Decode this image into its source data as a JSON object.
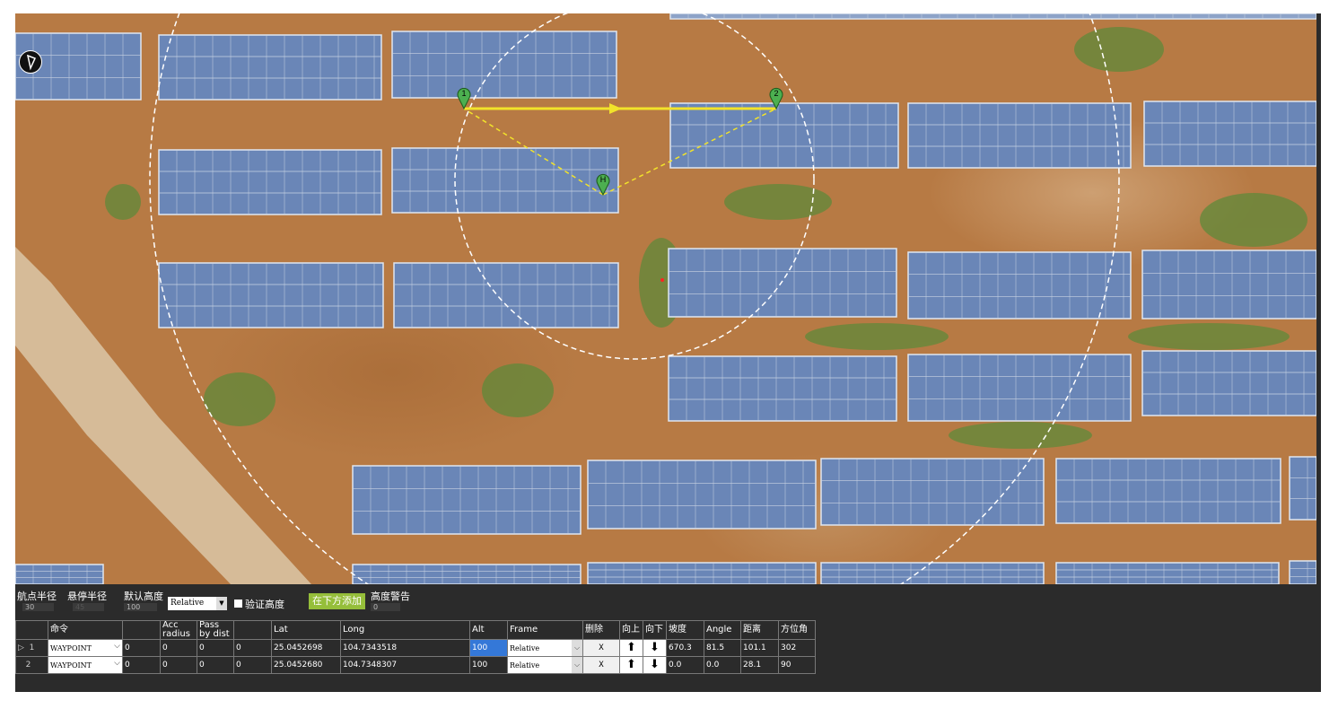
{
  "controls": {
    "wp_radius_label": "航点半径",
    "wp_radius_value": "30",
    "loiter_radius_label": "悬停半径",
    "loiter_radius_value": "45",
    "default_alt_label": "默认高度",
    "default_alt_value": "100",
    "alt_frame_value": "Relative",
    "verify_height_label": "验证高度",
    "add_below_label": "在下方添加",
    "alt_warn_label": "高度警告",
    "alt_warn_value": "0"
  },
  "map": {
    "waypoints": [
      {
        "label": "1"
      },
      {
        "label": "2"
      },
      {
        "label": "H"
      }
    ],
    "colors": {
      "route": "#f2e32a",
      "marker": "#4caf50",
      "ground": "#b77a44",
      "panel": "#6a86b7"
    }
  },
  "table": {
    "headers": [
      "",
      "命令",
      "",
      "Acc radius",
      "Pass by dist",
      "",
      "Lat",
      "Long",
      "Alt",
      "Frame",
      "删除",
      "向上",
      "向下",
      "坡度",
      "Angle",
      "距离",
      "方位角"
    ],
    "rows": [
      {
        "marker": "▷",
        "num": "1",
        "command": "WAYPOINT",
        "p1": "0",
        "p2": "0",
        "p3": "0",
        "p4": "0",
        "lat": "25.0452698",
        "long": "104.7343518",
        "alt": "100",
        "frame": "Relative",
        "delete": "X",
        "grad": "670.3",
        "angle": "81.5",
        "dist": "101.1",
        "az": "302"
      },
      {
        "marker": "",
        "num": "2",
        "command": "WAYPOINT",
        "p1": "0",
        "p2": "0",
        "p3": "0",
        "p4": "0",
        "lat": "25.0452680",
        "long": "104.7348307",
        "alt": "100",
        "frame": "Relative",
        "delete": "X",
        "grad": "0.0",
        "angle": "0.0",
        "dist": "28.1",
        "az": "90"
      }
    ]
  }
}
